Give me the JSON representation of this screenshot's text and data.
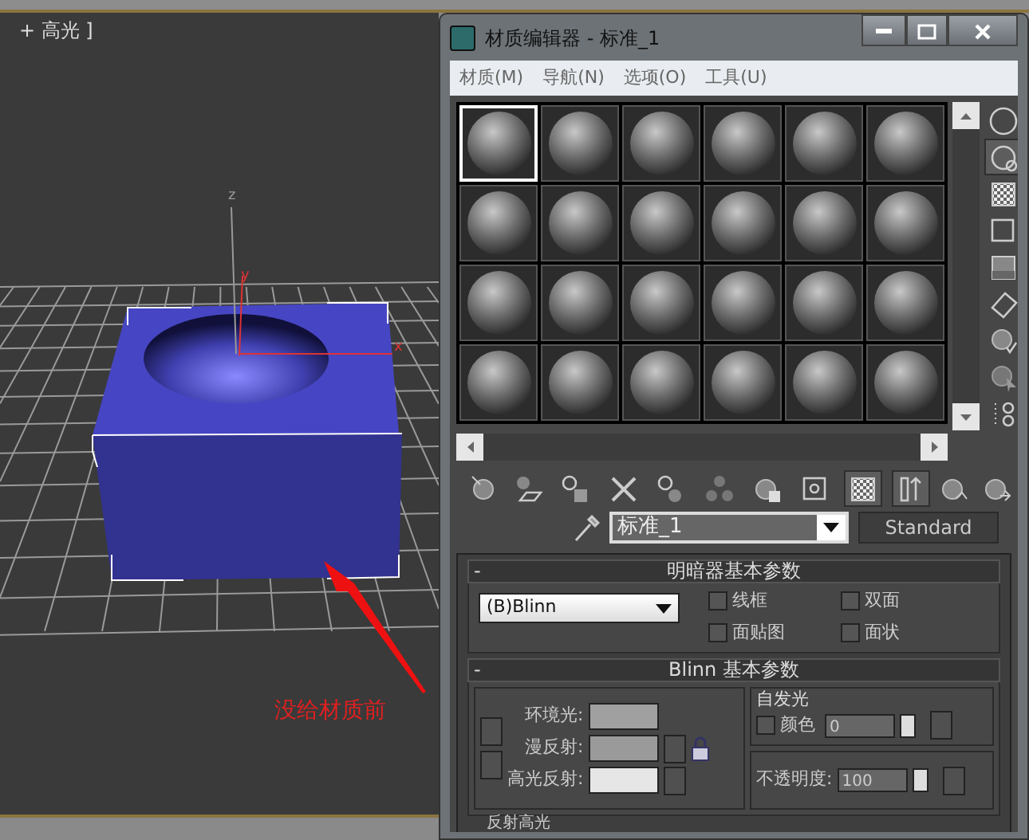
{
  "viewport": {
    "label": "+ 高光 ]",
    "axis_labels": [
      "z",
      "y",
      "x"
    ],
    "annotation": "没给材质前"
  },
  "window": {
    "title": "材质编辑器 - 标准_1"
  },
  "menu": [
    "材质(M)",
    "导航(N)",
    "选项(O)",
    "工具(U)"
  ],
  "sample_slots": [
    {
      "selected": true
    },
    {
      "selected": false
    },
    {
      "selected": false
    },
    {
      "selected": false
    },
    {
      "selected": false
    },
    {
      "selected": false
    },
    {
      "selected": false
    },
    {
      "selected": false
    },
    {
      "selected": false
    },
    {
      "selected": false
    },
    {
      "selected": false
    },
    {
      "selected": false
    },
    {
      "selected": false
    },
    {
      "selected": false
    },
    {
      "selected": false
    },
    {
      "selected": false
    },
    {
      "selected": false
    },
    {
      "selected": false
    },
    {
      "selected": false
    },
    {
      "selected": false
    },
    {
      "selected": false
    },
    {
      "selected": false
    },
    {
      "selected": false
    },
    {
      "selected": false
    }
  ],
  "side_toolbar": [
    {
      "pressed": false
    },
    {
      "pressed": true
    },
    {
      "pressed": false
    },
    {
      "pressed": false
    },
    {
      "pressed": false
    },
    {
      "pressed": false
    },
    {
      "pressed": false
    },
    {
      "pressed": false
    },
    {
      "pressed": false
    }
  ],
  "bottom_toolbar": [
    {
      "pressed": false
    },
    {
      "pressed": false
    },
    {
      "pressed": false
    },
    {
      "pressed": false
    },
    {
      "pressed": false
    },
    {
      "pressed": false
    },
    {
      "pressed": false
    },
    {
      "pressed": false
    },
    {
      "pressed": true
    },
    {
      "pressed": true
    },
    {
      "pressed": false
    },
    {
      "pressed": false
    }
  ],
  "material": {
    "name": "标准_1",
    "type_button": "Standard"
  },
  "shader_rollout": {
    "collapse_sign": "-",
    "title": "明暗器基本参数",
    "shader": "(B)Blinn",
    "options": [
      {
        "label": "线框",
        "checked": false
      },
      {
        "label": "双面",
        "checked": false
      },
      {
        "label": "面贴图",
        "checked": false
      },
      {
        "label": "面状",
        "checked": false
      }
    ]
  },
  "blinn_rollout": {
    "collapse_sign": "-",
    "title": "Blinn 基本参数",
    "colors": [
      {
        "label": "环境光:",
        "color": "#a0a0a0"
      },
      {
        "label": "漫反射:",
        "color": "#9a9a9a"
      },
      {
        "label": "高光反射:",
        "color": "#e6e6e6"
      }
    ],
    "self_illum": {
      "title": "自发光",
      "color_checkbox": {
        "label": "颜色",
        "checked": false
      },
      "value": "0"
    },
    "opacity": {
      "label": "不透明度:",
      "value": "100"
    }
  },
  "next_rollout": {
    "title": "反射高光"
  }
}
